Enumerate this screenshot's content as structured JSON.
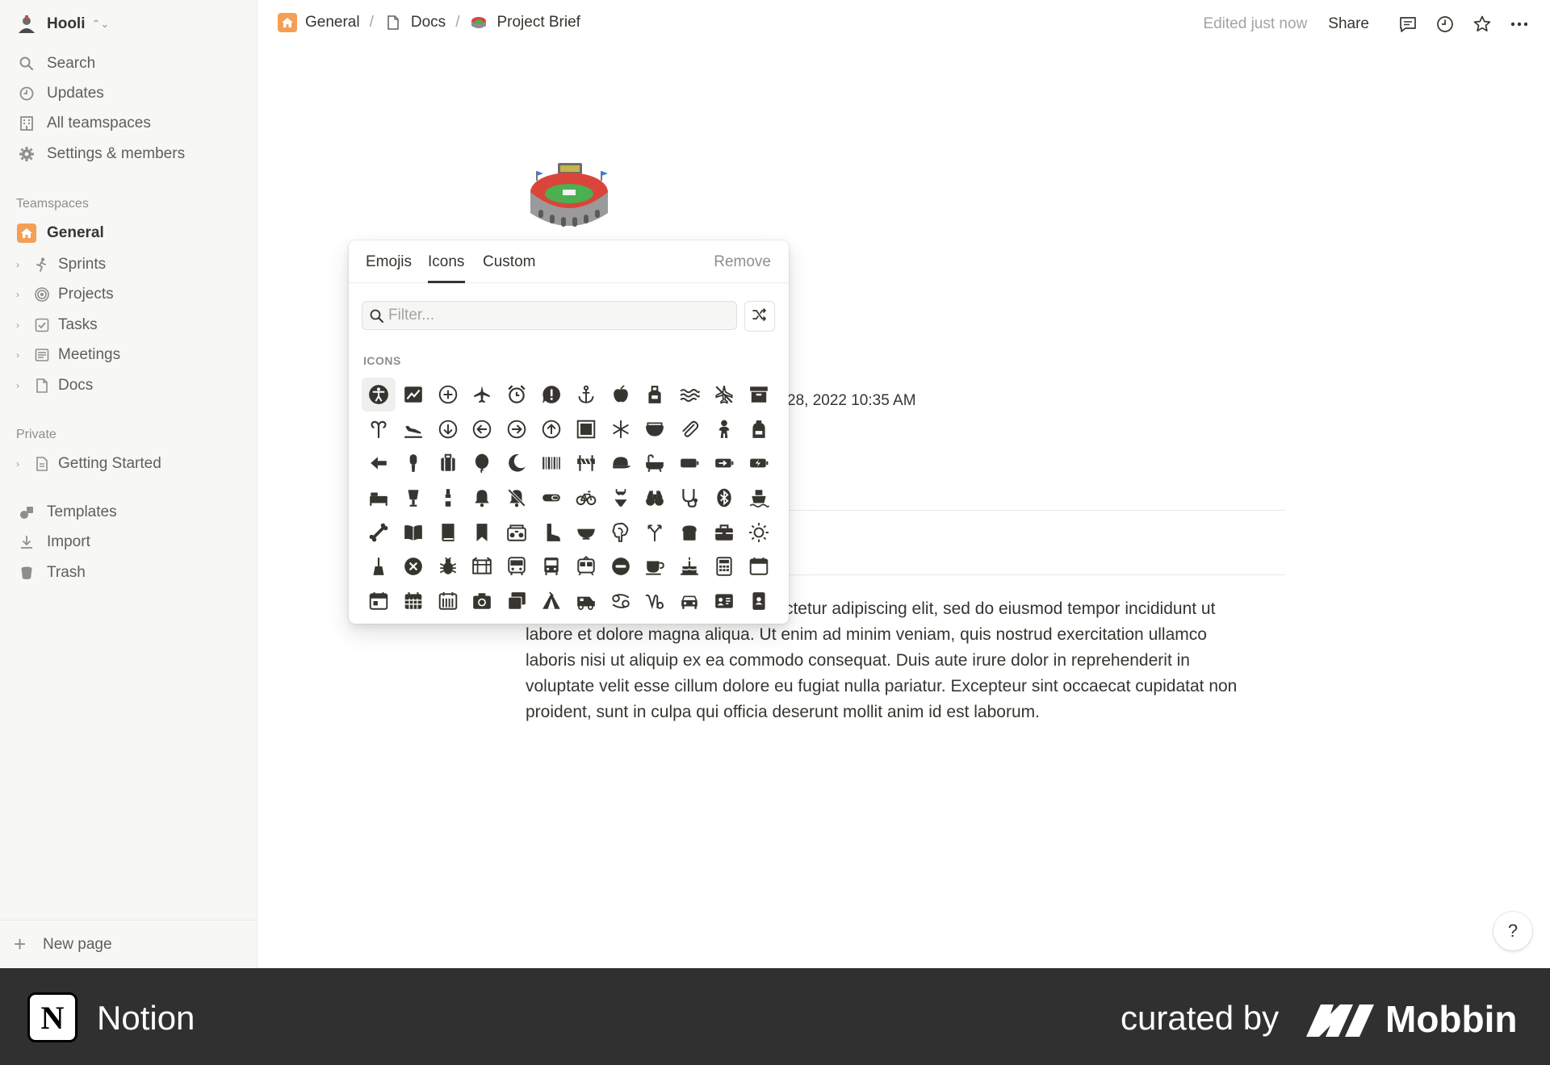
{
  "sidebar": {
    "workspace_name": "Hooli",
    "nav": [
      {
        "label": "Search",
        "icon": "search-icon"
      },
      {
        "label": "Updates",
        "icon": "clock-icon"
      },
      {
        "label": "All teamspaces",
        "icon": "building-icon"
      },
      {
        "label": "Settings & members",
        "icon": "gear-icon"
      }
    ],
    "teamspaces_label": "Teamspaces",
    "general_label": "General",
    "teamspace_items": [
      {
        "label": "Sprints",
        "icon": "runner-icon"
      },
      {
        "label": "Projects",
        "icon": "target-icon"
      },
      {
        "label": "Tasks",
        "icon": "checkbox-icon"
      },
      {
        "label": "Meetings",
        "icon": "notes-icon"
      },
      {
        "label": "Docs",
        "icon": "document-icon"
      }
    ],
    "private_label": "Private",
    "private_items": [
      {
        "label": "Getting Started",
        "icon": "document-icon"
      }
    ],
    "bottom_items": [
      {
        "label": "Templates",
        "icon": "shapes-icon"
      },
      {
        "label": "Import",
        "icon": "download-icon"
      },
      {
        "label": "Trash",
        "icon": "trash-icon"
      }
    ],
    "new_page_label": "New page"
  },
  "topbar": {
    "breadcrumb": [
      "General",
      "Docs",
      "Project Brief"
    ],
    "edited": "Edited just now",
    "share": "Share"
  },
  "page": {
    "date_fragment": "28, 2022 10:35 AM",
    "body_line1_tail": "ectetur adipiscing elit, sed do eiusmod tempor incididunt ut",
    "body_line2": "labore et dolore magna aliqua. Ut enim ad minim veniam, quis nostrud exercitation ullamco",
    "body_line3": "laboris nisi ut aliquip ex ea commodo consequat. Duis aute irure dolor in reprehenderit in",
    "body_line4": "voluptate velit esse cillum dolore eu fugiat nulla pariatur. Excepteur sint occaecat cupidatat non",
    "body_line5": "proident, sunt in culpa qui officia deserunt mollit anim id est laborum."
  },
  "picker": {
    "tabs": [
      "Emojis",
      "Icons",
      "Custom"
    ],
    "active_tab": "Icons",
    "remove": "Remove",
    "filter_placeholder": "Filter...",
    "section_label": "ICONS",
    "icons": [
      "accessibility-icon",
      "chart-line-icon",
      "add-circle-icon",
      "airplane-icon",
      "alarm-icon",
      "alert-bubble-icon",
      "anchor-icon",
      "apple-icon",
      "apron-icon",
      "waves-icon",
      "plane-off-icon",
      "archive-icon",
      "aries-icon",
      "plane-landing-icon",
      "arrow-down-circle-icon",
      "arrow-left-circle-icon",
      "arrow-right-circle-icon",
      "arrow-up-circle-icon",
      "frame-icon",
      "asterisk-icon",
      "tray-icon",
      "paperclip-icon",
      "baby-icon",
      "backpack-icon",
      "arrow-left-icon",
      "microphone-icon",
      "luggage-icon",
      "balloon-icon",
      "moon-icon",
      "barcode-icon",
      "barrier-icon",
      "cap-icon",
      "bathtub-icon",
      "battery-icon",
      "battery-charging-icon",
      "battery-bolt-icon",
      "bed-icon",
      "beer-icon",
      "bottle-icon",
      "bell-icon",
      "bell-off-icon",
      "pill-icon",
      "bicycle-icon",
      "bikini-icon",
      "binoculars-icon",
      "biohazard-icon",
      "bluetooth-icon",
      "boat-icon",
      "bone-icon",
      "book-open-icon",
      "book-icon",
      "bookmark-icon",
      "boombox-icon",
      "boot-icon",
      "bowl-icon",
      "brain-icon",
      "branch-icon",
      "bread-icon",
      "briefcase-icon",
      "sun-icon",
      "broom-icon",
      "close-circle-icon",
      "bug-icon",
      "building-icon",
      "bus-icon",
      "bus-front-icon",
      "tram-icon",
      "coin-icon",
      "coffee-icon",
      "cake-icon",
      "calculator-icon",
      "calendar-icon",
      "calendar-day-icon",
      "calendar-grid-icon",
      "calendar-week-icon",
      "camera-icon",
      "cards-icon",
      "tent-icon",
      "camper-icon",
      "cancer-icon",
      "capricorn-icon",
      "car-icon",
      "id-card-icon",
      "phone-card-icon"
    ]
  },
  "footer": {
    "app_name": "Notion",
    "curated_by": "curated by",
    "brand": "Mobbin"
  },
  "colors": {
    "sidebar_bg": "#f7f7f5",
    "accent_orange": "#f59e55",
    "footer_bg": "#303030",
    "text": "#37352f",
    "muted": "#8f8e8a"
  }
}
